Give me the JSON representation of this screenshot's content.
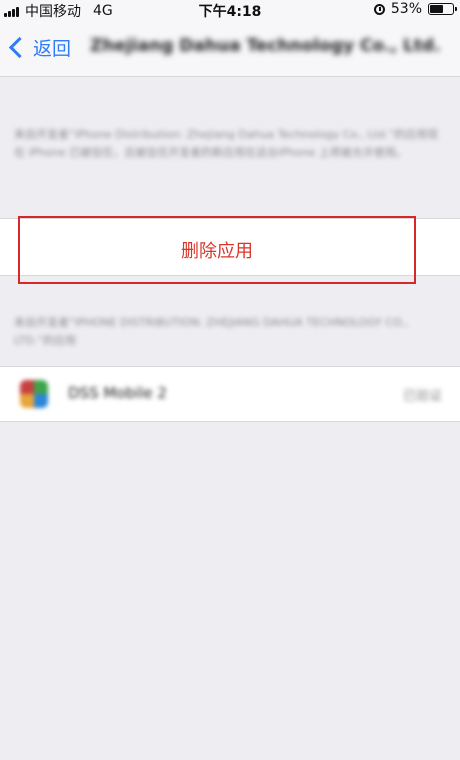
{
  "status_bar": {
    "carrier": "中国移动",
    "network": "4G",
    "time": "下午4:18",
    "battery": "53%",
    "battery_level": 0.53,
    "icons": [
      "signal-icon",
      "alarm-icon",
      "battery-icon"
    ]
  },
  "nav": {
    "back_label": "返回",
    "title": "Zhejiang Dahua Technology Co., Ltd."
  },
  "main": {
    "description_top": "来自开发者“iPhone Distribution: Zhejiang Dahua Technology Co., Ltd.”的应用现在 iPhone 已被信任，且被信任开发者的新应用在这台iPhone 上将被允许使用。",
    "delete_label": "删除应用",
    "description_bottom": "来自开发者“IPHONE DISTRIBUTION: ZHEJIANG DAHUA TECHNOLOGY CO., LTD.”的应用",
    "apps": [
      {
        "name": "DSS Mobile 2",
        "status": "已验证"
      }
    ]
  },
  "colors": {
    "accent": "#2f7cf6",
    "destructive": "#d9352b",
    "highlight_border": "#d62828",
    "background": "#eeeef2"
  }
}
